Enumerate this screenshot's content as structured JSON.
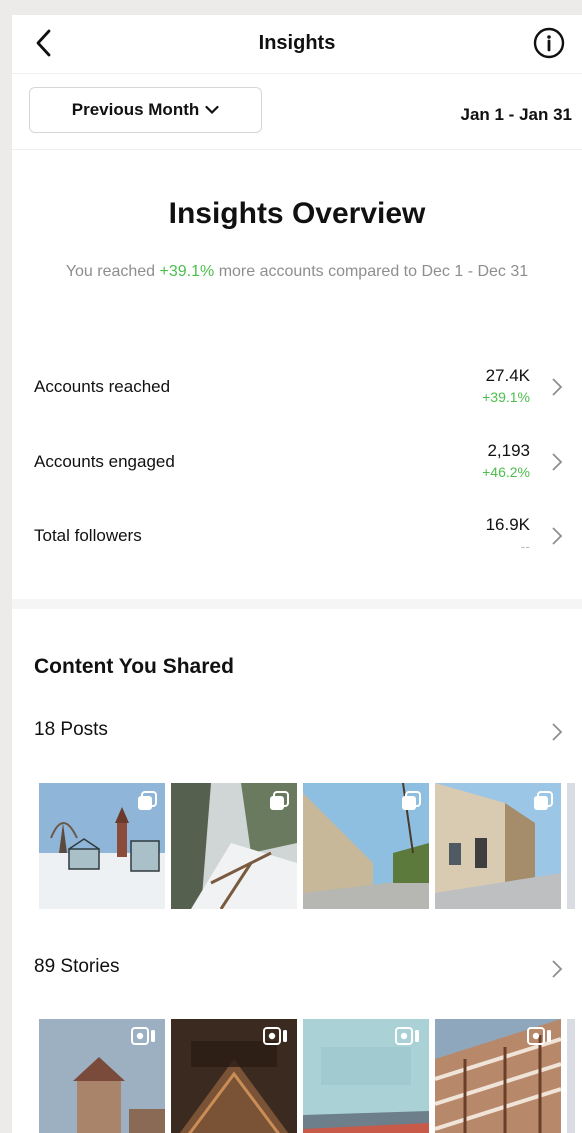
{
  "header": {
    "title": "Insights",
    "back_icon": "chevron-left-icon",
    "info_icon": "info-icon"
  },
  "filter": {
    "period_label": "Previous Month",
    "date_range": "Jan 1 - Jan 31"
  },
  "overview": {
    "title": "Insights Overview",
    "sub_prefix": "You reached ",
    "sub_highlight": "+39.1%",
    "sub_suffix": " more accounts compared to Dec 1 - Dec 31"
  },
  "metrics": [
    {
      "label": "Accounts reached",
      "value": "27.4K",
      "change": "+39.1%"
    },
    {
      "label": "Accounts engaged",
      "value": "2,193",
      "change": "+46.2%"
    },
    {
      "label": "Total followers",
      "value": "16.9K",
      "change": "--"
    }
  ],
  "content": {
    "title": "Content You Shared",
    "posts_label": "18 Posts",
    "stories_label": "89 Stories"
  },
  "colors": {
    "positive": "#4dbe4d",
    "background": "#ffffff"
  }
}
